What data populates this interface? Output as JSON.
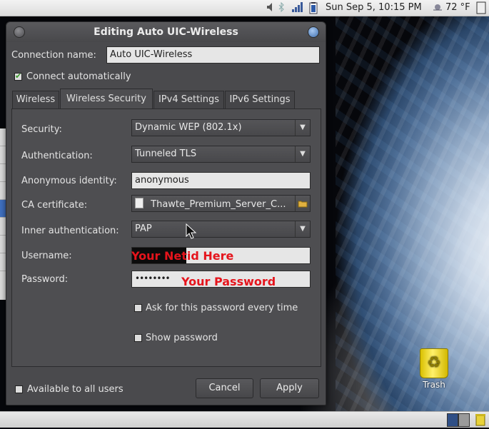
{
  "top_panel": {
    "clock": "Sun Sep  5, 10:15 PM",
    "weather": "72 °F"
  },
  "dialog": {
    "title": "Editing Auto UIC-Wireless",
    "connection_name_label": "Connection name:",
    "connection_name_value": "Auto UIC-Wireless",
    "connect_auto_label": "Connect automatically",
    "tabs": [
      "Wireless",
      "Wireless Security",
      "IPv4 Settings",
      "IPv6 Settings"
    ],
    "security": {
      "security_label": "Security:",
      "security_value": "Dynamic WEP (802.1x)",
      "auth_label": "Authentication:",
      "auth_value": "Tunneled TLS",
      "anon_label": "Anonymous identity:",
      "anon_value": "anonymous",
      "ca_label": "CA certificate:",
      "ca_value": "Thawte_Premium_Server_C...",
      "inner_label": "Inner authentication:",
      "inner_value": "PAP",
      "username_label": "Username:",
      "username_note": "Your Netid Here",
      "password_label": "Password:",
      "password_dots": "••••••••",
      "password_note": "Your Password",
      "ask_label": "Ask for this password every time",
      "show_label": "Show password"
    },
    "available_label": "Available to all users",
    "cancel_label": "Cancel",
    "apply_label": "Apply"
  },
  "desktop": {
    "trash_label": "Trash"
  },
  "colors": {
    "annotation": "#e5141c",
    "dialog_bg": "#4a4a4d"
  }
}
